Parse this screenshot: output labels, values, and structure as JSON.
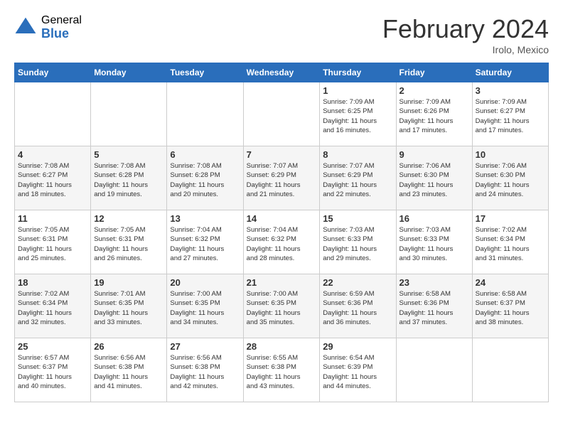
{
  "logo": {
    "general": "General",
    "blue": "Blue"
  },
  "title": "February 2024",
  "location": "Irolo, Mexico",
  "days_of_week": [
    "Sunday",
    "Monday",
    "Tuesday",
    "Wednesday",
    "Thursday",
    "Friday",
    "Saturday"
  ],
  "weeks": [
    [
      {
        "day": "",
        "info": ""
      },
      {
        "day": "",
        "info": ""
      },
      {
        "day": "",
        "info": ""
      },
      {
        "day": "",
        "info": ""
      },
      {
        "day": "1",
        "info": "Sunrise: 7:09 AM\nSunset: 6:25 PM\nDaylight: 11 hours\nand 16 minutes."
      },
      {
        "day": "2",
        "info": "Sunrise: 7:09 AM\nSunset: 6:26 PM\nDaylight: 11 hours\nand 17 minutes."
      },
      {
        "day": "3",
        "info": "Sunrise: 7:09 AM\nSunset: 6:27 PM\nDaylight: 11 hours\nand 17 minutes."
      }
    ],
    [
      {
        "day": "4",
        "info": "Sunrise: 7:08 AM\nSunset: 6:27 PM\nDaylight: 11 hours\nand 18 minutes."
      },
      {
        "day": "5",
        "info": "Sunrise: 7:08 AM\nSunset: 6:28 PM\nDaylight: 11 hours\nand 19 minutes."
      },
      {
        "day": "6",
        "info": "Sunrise: 7:08 AM\nSunset: 6:28 PM\nDaylight: 11 hours\nand 20 minutes."
      },
      {
        "day": "7",
        "info": "Sunrise: 7:07 AM\nSunset: 6:29 PM\nDaylight: 11 hours\nand 21 minutes."
      },
      {
        "day": "8",
        "info": "Sunrise: 7:07 AM\nSunset: 6:29 PM\nDaylight: 11 hours\nand 22 minutes."
      },
      {
        "day": "9",
        "info": "Sunrise: 7:06 AM\nSunset: 6:30 PM\nDaylight: 11 hours\nand 23 minutes."
      },
      {
        "day": "10",
        "info": "Sunrise: 7:06 AM\nSunset: 6:30 PM\nDaylight: 11 hours\nand 24 minutes."
      }
    ],
    [
      {
        "day": "11",
        "info": "Sunrise: 7:05 AM\nSunset: 6:31 PM\nDaylight: 11 hours\nand 25 minutes."
      },
      {
        "day": "12",
        "info": "Sunrise: 7:05 AM\nSunset: 6:31 PM\nDaylight: 11 hours\nand 26 minutes."
      },
      {
        "day": "13",
        "info": "Sunrise: 7:04 AM\nSunset: 6:32 PM\nDaylight: 11 hours\nand 27 minutes."
      },
      {
        "day": "14",
        "info": "Sunrise: 7:04 AM\nSunset: 6:32 PM\nDaylight: 11 hours\nand 28 minutes."
      },
      {
        "day": "15",
        "info": "Sunrise: 7:03 AM\nSunset: 6:33 PM\nDaylight: 11 hours\nand 29 minutes."
      },
      {
        "day": "16",
        "info": "Sunrise: 7:03 AM\nSunset: 6:33 PM\nDaylight: 11 hours\nand 30 minutes."
      },
      {
        "day": "17",
        "info": "Sunrise: 7:02 AM\nSunset: 6:34 PM\nDaylight: 11 hours\nand 31 minutes."
      }
    ],
    [
      {
        "day": "18",
        "info": "Sunrise: 7:02 AM\nSunset: 6:34 PM\nDaylight: 11 hours\nand 32 minutes."
      },
      {
        "day": "19",
        "info": "Sunrise: 7:01 AM\nSunset: 6:35 PM\nDaylight: 11 hours\nand 33 minutes."
      },
      {
        "day": "20",
        "info": "Sunrise: 7:00 AM\nSunset: 6:35 PM\nDaylight: 11 hours\nand 34 minutes."
      },
      {
        "day": "21",
        "info": "Sunrise: 7:00 AM\nSunset: 6:35 PM\nDaylight: 11 hours\nand 35 minutes."
      },
      {
        "day": "22",
        "info": "Sunrise: 6:59 AM\nSunset: 6:36 PM\nDaylight: 11 hours\nand 36 minutes."
      },
      {
        "day": "23",
        "info": "Sunrise: 6:58 AM\nSunset: 6:36 PM\nDaylight: 11 hours\nand 37 minutes."
      },
      {
        "day": "24",
        "info": "Sunrise: 6:58 AM\nSunset: 6:37 PM\nDaylight: 11 hours\nand 38 minutes."
      }
    ],
    [
      {
        "day": "25",
        "info": "Sunrise: 6:57 AM\nSunset: 6:37 PM\nDaylight: 11 hours\nand 40 minutes."
      },
      {
        "day": "26",
        "info": "Sunrise: 6:56 AM\nSunset: 6:38 PM\nDaylight: 11 hours\nand 41 minutes."
      },
      {
        "day": "27",
        "info": "Sunrise: 6:56 AM\nSunset: 6:38 PM\nDaylight: 11 hours\nand 42 minutes."
      },
      {
        "day": "28",
        "info": "Sunrise: 6:55 AM\nSunset: 6:38 PM\nDaylight: 11 hours\nand 43 minutes."
      },
      {
        "day": "29",
        "info": "Sunrise: 6:54 AM\nSunset: 6:39 PM\nDaylight: 11 hours\nand 44 minutes."
      },
      {
        "day": "",
        "info": ""
      },
      {
        "day": "",
        "info": ""
      }
    ]
  ]
}
